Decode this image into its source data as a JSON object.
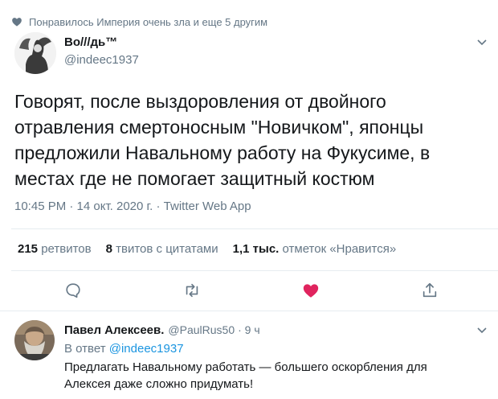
{
  "social_context": {
    "text": "Понравилось Империя очень зла и еще 5 другим",
    "icon": "heart-icon"
  },
  "tweet": {
    "author_name": "Во///дь™",
    "author_handle": "@indeec1937",
    "text": "Говорят, после выздоровления от двойного отравления смертоносным \"Новичком\", японцы предложили Навальному работу на Фукусиме, в местах где не помогает защитный костюм",
    "timestamp": "10:45 PM · 14 окт. 2020 г. · Twitter Web App",
    "stats": {
      "retweets_value": "215",
      "retweets_label": "ретвитов",
      "quotes_value": "8",
      "quotes_label": "твитов с цитатами",
      "likes_value": "1,1 тыс.",
      "likes_label": "отметок «Нравится»"
    },
    "liked": true,
    "colors": {
      "like": "#e0245e",
      "action": "#657786",
      "link": "#1b95e0"
    }
  },
  "reply": {
    "author_name": "Павел Алексеев.",
    "author_handle": "@PaulRus50",
    "time": "· 9 ч",
    "in_reply_prefix": "В ответ",
    "in_reply_handle": "@indeec1937",
    "text_line1": "Предлагать Навальному работать — большего оскорбления для",
    "text_line2": "Алексея даже сложно придумать!"
  }
}
